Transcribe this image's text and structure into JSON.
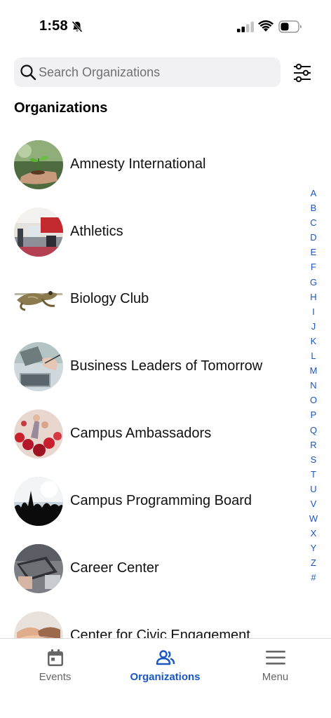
{
  "status_bar": {
    "time": "1:58",
    "bell_icon": "bell-slash-icon",
    "signal_icon": "cellular-signal-icon",
    "wifi_icon": "wifi-icon",
    "battery_icon": "battery-icon"
  },
  "search": {
    "placeholder": "Search Organizations",
    "value": "",
    "icon": "search-icon",
    "filter_icon": "filter-sliders-icon"
  },
  "section": {
    "title": "Organizations"
  },
  "organizations": [
    {
      "name": "Amnesty International",
      "avatar": "seedling-in-hand-photo"
    },
    {
      "name": "Athletics",
      "avatar": "gym-interior-photo"
    },
    {
      "name": "Biology Club",
      "avatar": "frog-photo"
    },
    {
      "name": "Business Leaders of Tomorrow",
      "avatar": "laptop-desk-photo"
    },
    {
      "name": "Campus Ambassadors",
      "avatar": "crowd-cheering-photo"
    },
    {
      "name": "Campus Programming Board",
      "avatar": "concert-crowd-photo"
    },
    {
      "name": "Career Center",
      "avatar": "office-desk-photo"
    },
    {
      "name": "Center for Civic Engagement",
      "avatar": "stacked-hands-photo"
    }
  ],
  "alphabet": [
    "A",
    "B",
    "C",
    "D",
    "E",
    "F",
    "G",
    "H",
    "I",
    "J",
    "K",
    "L",
    "M",
    "N",
    "O",
    "P",
    "Q",
    "R",
    "S",
    "T",
    "U",
    "V",
    "W",
    "X",
    "Y",
    "Z",
    "#"
  ],
  "tab_bar": {
    "tabs": [
      {
        "label": "Events",
        "icon": "calendar-icon",
        "active": false
      },
      {
        "label": "Organizations",
        "icon": "people-icon",
        "active": true
      },
      {
        "label": "Menu",
        "icon": "hamburger-menu-icon",
        "active": false
      }
    ]
  },
  "colors": {
    "accent": "#1a56c4",
    "inactive_tab": "#666666",
    "search_background": "#f1f1f3"
  }
}
